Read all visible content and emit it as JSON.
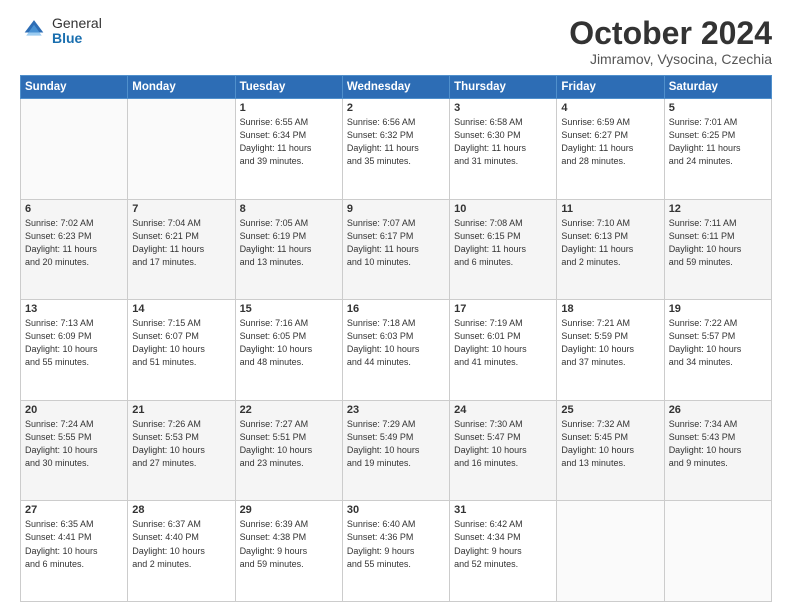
{
  "header": {
    "logo_general": "General",
    "logo_blue": "Blue",
    "month_title": "October 2024",
    "subtitle": "Jimramov, Vysocina, Czechia"
  },
  "weekdays": [
    "Sunday",
    "Monday",
    "Tuesday",
    "Wednesday",
    "Thursday",
    "Friday",
    "Saturday"
  ],
  "weeks": [
    [
      {
        "day": "",
        "info": ""
      },
      {
        "day": "",
        "info": ""
      },
      {
        "day": "1",
        "info": "Sunrise: 6:55 AM\nSunset: 6:34 PM\nDaylight: 11 hours\nand 39 minutes."
      },
      {
        "day": "2",
        "info": "Sunrise: 6:56 AM\nSunset: 6:32 PM\nDaylight: 11 hours\nand 35 minutes."
      },
      {
        "day": "3",
        "info": "Sunrise: 6:58 AM\nSunset: 6:30 PM\nDaylight: 11 hours\nand 31 minutes."
      },
      {
        "day": "4",
        "info": "Sunrise: 6:59 AM\nSunset: 6:27 PM\nDaylight: 11 hours\nand 28 minutes."
      },
      {
        "day": "5",
        "info": "Sunrise: 7:01 AM\nSunset: 6:25 PM\nDaylight: 11 hours\nand 24 minutes."
      }
    ],
    [
      {
        "day": "6",
        "info": "Sunrise: 7:02 AM\nSunset: 6:23 PM\nDaylight: 11 hours\nand 20 minutes."
      },
      {
        "day": "7",
        "info": "Sunrise: 7:04 AM\nSunset: 6:21 PM\nDaylight: 11 hours\nand 17 minutes."
      },
      {
        "day": "8",
        "info": "Sunrise: 7:05 AM\nSunset: 6:19 PM\nDaylight: 11 hours\nand 13 minutes."
      },
      {
        "day": "9",
        "info": "Sunrise: 7:07 AM\nSunset: 6:17 PM\nDaylight: 11 hours\nand 10 minutes."
      },
      {
        "day": "10",
        "info": "Sunrise: 7:08 AM\nSunset: 6:15 PM\nDaylight: 11 hours\nand 6 minutes."
      },
      {
        "day": "11",
        "info": "Sunrise: 7:10 AM\nSunset: 6:13 PM\nDaylight: 11 hours\nand 2 minutes."
      },
      {
        "day": "12",
        "info": "Sunrise: 7:11 AM\nSunset: 6:11 PM\nDaylight: 10 hours\nand 59 minutes."
      }
    ],
    [
      {
        "day": "13",
        "info": "Sunrise: 7:13 AM\nSunset: 6:09 PM\nDaylight: 10 hours\nand 55 minutes."
      },
      {
        "day": "14",
        "info": "Sunrise: 7:15 AM\nSunset: 6:07 PM\nDaylight: 10 hours\nand 51 minutes."
      },
      {
        "day": "15",
        "info": "Sunrise: 7:16 AM\nSunset: 6:05 PM\nDaylight: 10 hours\nand 48 minutes."
      },
      {
        "day": "16",
        "info": "Sunrise: 7:18 AM\nSunset: 6:03 PM\nDaylight: 10 hours\nand 44 minutes."
      },
      {
        "day": "17",
        "info": "Sunrise: 7:19 AM\nSunset: 6:01 PM\nDaylight: 10 hours\nand 41 minutes."
      },
      {
        "day": "18",
        "info": "Sunrise: 7:21 AM\nSunset: 5:59 PM\nDaylight: 10 hours\nand 37 minutes."
      },
      {
        "day": "19",
        "info": "Sunrise: 7:22 AM\nSunset: 5:57 PM\nDaylight: 10 hours\nand 34 minutes."
      }
    ],
    [
      {
        "day": "20",
        "info": "Sunrise: 7:24 AM\nSunset: 5:55 PM\nDaylight: 10 hours\nand 30 minutes."
      },
      {
        "day": "21",
        "info": "Sunrise: 7:26 AM\nSunset: 5:53 PM\nDaylight: 10 hours\nand 27 minutes."
      },
      {
        "day": "22",
        "info": "Sunrise: 7:27 AM\nSunset: 5:51 PM\nDaylight: 10 hours\nand 23 minutes."
      },
      {
        "day": "23",
        "info": "Sunrise: 7:29 AM\nSunset: 5:49 PM\nDaylight: 10 hours\nand 19 minutes."
      },
      {
        "day": "24",
        "info": "Sunrise: 7:30 AM\nSunset: 5:47 PM\nDaylight: 10 hours\nand 16 minutes."
      },
      {
        "day": "25",
        "info": "Sunrise: 7:32 AM\nSunset: 5:45 PM\nDaylight: 10 hours\nand 13 minutes."
      },
      {
        "day": "26",
        "info": "Sunrise: 7:34 AM\nSunset: 5:43 PM\nDaylight: 10 hours\nand 9 minutes."
      }
    ],
    [
      {
        "day": "27",
        "info": "Sunrise: 6:35 AM\nSunset: 4:41 PM\nDaylight: 10 hours\nand 6 minutes."
      },
      {
        "day": "28",
        "info": "Sunrise: 6:37 AM\nSunset: 4:40 PM\nDaylight: 10 hours\nand 2 minutes."
      },
      {
        "day": "29",
        "info": "Sunrise: 6:39 AM\nSunset: 4:38 PM\nDaylight: 9 hours\nand 59 minutes."
      },
      {
        "day": "30",
        "info": "Sunrise: 6:40 AM\nSunset: 4:36 PM\nDaylight: 9 hours\nand 55 minutes."
      },
      {
        "day": "31",
        "info": "Sunrise: 6:42 AM\nSunset: 4:34 PM\nDaylight: 9 hours\nand 52 minutes."
      },
      {
        "day": "",
        "info": ""
      },
      {
        "day": "",
        "info": ""
      }
    ]
  ]
}
